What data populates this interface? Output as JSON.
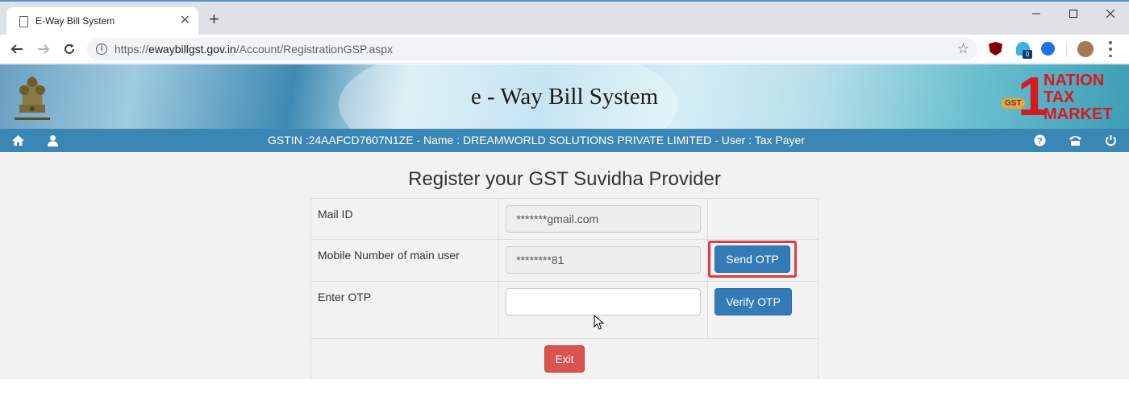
{
  "browser": {
    "tab_title": "E-Way Bill System",
    "new_tab_symbol": "+",
    "close_symbol": "✕",
    "url_scheme": "https://",
    "url_host": "ewaybillgst.gov.in",
    "url_path": "/Account/RegistrationGSP.aspx",
    "extension_badge": "0"
  },
  "header": {
    "site_title": "e - Way Bill System",
    "brand_one": "1",
    "brand_line1": "NATION",
    "brand_line2": "TAX",
    "brand_line3": "MARKET",
    "brand_gst": "GST",
    "user_info": "GSTIN :24AAFCD7607N1ZE - Name : DREAMWORLD SOLUTIONS PRIVATE LIMITED - User : Tax Payer"
  },
  "main": {
    "heading": "Register your GST Suvidha Provider",
    "rows": [
      {
        "label": "Mail ID",
        "value": "*******gmail.com"
      },
      {
        "label": "Mobile Number of main user",
        "value": "********81",
        "action": "Send OTP"
      },
      {
        "label": "Enter OTP",
        "value": "",
        "action": "Verify OTP"
      }
    ],
    "exit_label": "Exit"
  },
  "colors": {
    "nav_bar": "#3a87b6",
    "primary_button": "#337ab7",
    "danger_button": "#d9534f",
    "highlight_box": "#e23b3b"
  }
}
